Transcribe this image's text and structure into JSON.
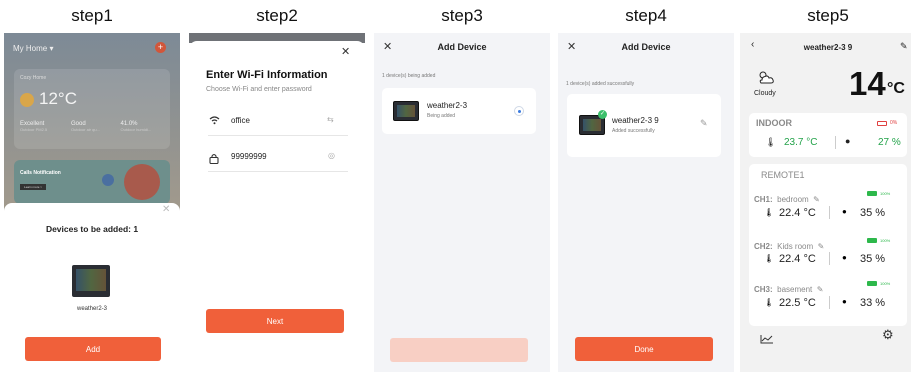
{
  "steps": [
    {
      "label": "step1"
    },
    {
      "label": "step2"
    },
    {
      "label": "step3"
    },
    {
      "label": "step4"
    },
    {
      "label": "step5"
    }
  ],
  "step1": {
    "home": "My Home",
    "home_card": "Cozy Home",
    "temp": "12°C",
    "metrics": [
      {
        "value": "Excellent",
        "label": "Outdoor PM2.5"
      },
      {
        "value": "Good",
        "label": "Outdoor air qu..."
      },
      {
        "value": "41.0%",
        "label": "Outdoor humidi..."
      }
    ],
    "calls_title": "Calls Notification",
    "calls_btn": "Learn more >",
    "sheet_title": "Devices to be added: 1",
    "device_name": "weather2-3",
    "add_btn": "Add"
  },
  "step2": {
    "title": "Enter Wi-Fi Information",
    "subtitle": "Choose Wi-Fi and enter password",
    "ssid": "office",
    "password": "99999999",
    "next_btn": "Next"
  },
  "step3": {
    "title": "Add Device",
    "status": "1 device(s) being added",
    "device_name": "weather2-3",
    "device_status": "Being added"
  },
  "step4": {
    "title": "Add Device",
    "status": "1 device(s) added successfully",
    "device_name": "weather2-3 9",
    "device_status": "Added successfully",
    "done_btn": "Done"
  },
  "step5": {
    "title": "weather2-3 9",
    "weather": "Cloudy",
    "temp_big": "14",
    "temp_unit": "°C",
    "indoor": {
      "label": "INDOOR",
      "battery": "0%",
      "temp": "23.7 °C",
      "humidity": "27 %"
    },
    "remote_label": "REMOTE1",
    "channels": [
      {
        "id": "CH1:",
        "name": "bedroom",
        "battery": "100%",
        "temp": "22.4 °C",
        "humidity": "35 %"
      },
      {
        "id": "CH2:",
        "name": "Kids room",
        "battery": "100%",
        "temp": "22.4 °C",
        "humidity": "35 %"
      },
      {
        "id": "CH3:",
        "name": "basement",
        "battery": "100%",
        "temp": "22.5 °C",
        "humidity": "33 %"
      }
    ]
  },
  "colors": {
    "accent": "#f0603a",
    "accent_pale": "#f8cfc4",
    "success": "#23a34a"
  }
}
